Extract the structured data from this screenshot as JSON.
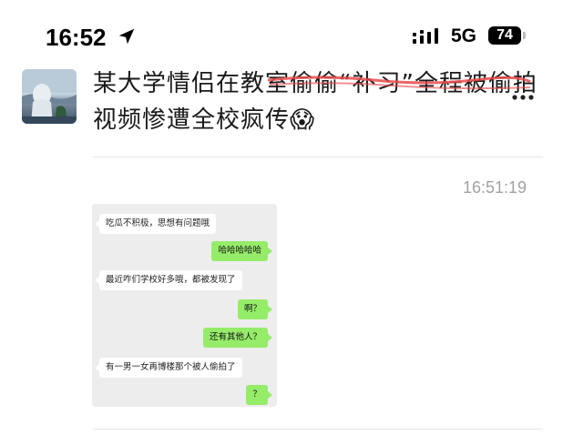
{
  "status_bar": {
    "time": "16:52",
    "network": "5G",
    "battery": "74"
  },
  "post": {
    "title": "某大学情侣在教室偷偷“补习”全程被偷拍视频惨遭全校疯传😱",
    "timestamp": "16:51:19"
  },
  "chat": {
    "messages": [
      {
        "side": "left",
        "text": "吃瓜不积极，思想有问题哦"
      },
      {
        "side": "right",
        "text": "哈哈哈哈哈"
      },
      {
        "side": "left",
        "text": "最近咋们学校好多哦，都被发现了"
      },
      {
        "side": "right",
        "text": "啊？"
      },
      {
        "side": "right",
        "text": "还有其他人？"
      },
      {
        "side": "left",
        "text": "有一男一女再博楼那个被人偷拍了"
      },
      {
        "side": "right",
        "text": "？"
      }
    ]
  },
  "colors": {
    "bubble_right": "#95ec69",
    "bubble_left": "#ffffff",
    "chat_bg": "#ededed",
    "scribble": "#e84a4a"
  },
  "icons": [
    "location-arrow-icon",
    "signal-icon",
    "battery-icon",
    "more-icon"
  ]
}
